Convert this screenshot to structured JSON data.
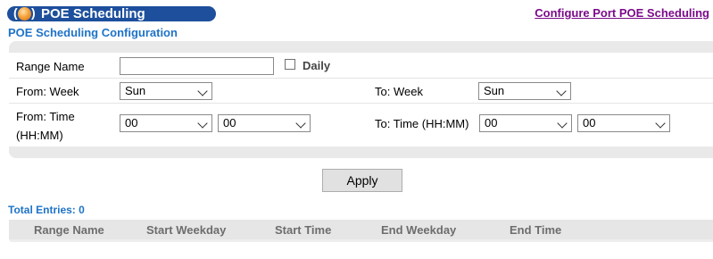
{
  "header": {
    "title": "POE Scheduling",
    "link": "Configure Port POE Scheduling"
  },
  "section_title": "POE Scheduling Configuration",
  "form": {
    "range_name_label": "Range Name",
    "range_name_value": "",
    "daily_label": "Daily",
    "daily_checked": false,
    "from_week_label": "From: Week",
    "from_week_value": "Sun",
    "to_week_label": "To: Week",
    "to_week_value": "Sun",
    "from_time_label_line1": "From: Time",
    "from_time_label_line2": "(HH:MM)",
    "from_hour": "00",
    "from_minute": "00",
    "to_time_label": "To: Time (HH:MM)",
    "to_hour": "00",
    "to_minute": "00"
  },
  "apply_label": "Apply",
  "table": {
    "total_entries": "Total Entries: 0",
    "columns": [
      "Range Name",
      "Start Weekday",
      "Start Time",
      "End Weekday",
      "End Time"
    ]
  }
}
